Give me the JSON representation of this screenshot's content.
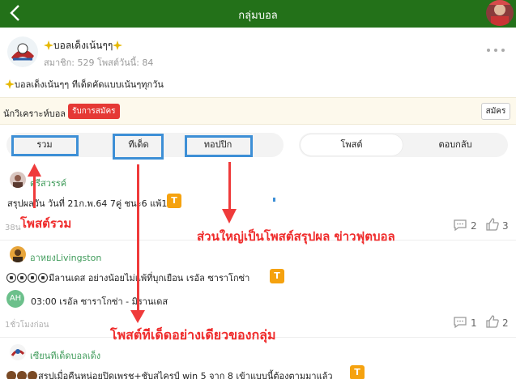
{
  "header": {
    "title": "กลุ่มบอล"
  },
  "group": {
    "name": "บอลเด็งเน้นๆๆ",
    "stats": "สมาชิก: 529 โพสต์วันนี้: 84",
    "description": "บอลเด็งเน้นๆๆ ทีเด็ดคัดแบบเน้นๆทุกวัน"
  },
  "analyst": {
    "label": "นักวิเคราะห์บอล",
    "badge": "รับการสมัคร",
    "apply": "สมัคร"
  },
  "filters": [
    "รวม",
    "ทีเด็ด",
    "ทอปปิก"
  ],
  "sort": [
    "โพสต์",
    "ตอบกลับ"
  ],
  "posts": [
    {
      "author": "ตรีสวรรค์",
      "body": "สรุปผลวัน วันที่ 21ก.พ.64 7คู่ ชนะ6 แพ้1",
      "badge": "T",
      "time": "38น",
      "comments": "2",
      "likes": "3"
    },
    {
      "author": "อาหยงLivingston",
      "body": "มีลานเดส อย่างน้อยไม่แพ้ที่บุกเยือน เรอัล ซาราโกซ่า",
      "badge": "T",
      "tag": "AH",
      "match": "03:00 เรอัล ซาราโกซ่า - มิรานเดส",
      "time": "1ชั่วโมงก่อน",
      "comments": "1",
      "likes": "2"
    },
    {
      "author": "เซียนทีเด็ดบอลเด็ง",
      "body": "สรุปเมื่อคืนหน่อยปิดเพรช+ชับสไครป์ win 5 จาก 8 เข้าแบบนี้ต้องตามมาแล้ว",
      "badge": "T"
    }
  ],
  "annotations": {
    "all_posts": "โพสต์รวม",
    "mostly_summary": "ส่วนใหญ่เป็นโพสต์สรุปผล ข่าวฟุตบอล",
    "tips_only": "โพสต์ทีเด็ดอย่างเดียวของกลุ่ม"
  },
  "colors": {
    "header": "#237119",
    "accent_green": "#3f9b5a",
    "badge_orange": "#f5a20f",
    "annotation_red": "#ef2b2b",
    "highlight_blue": "#3d8fd6"
  }
}
